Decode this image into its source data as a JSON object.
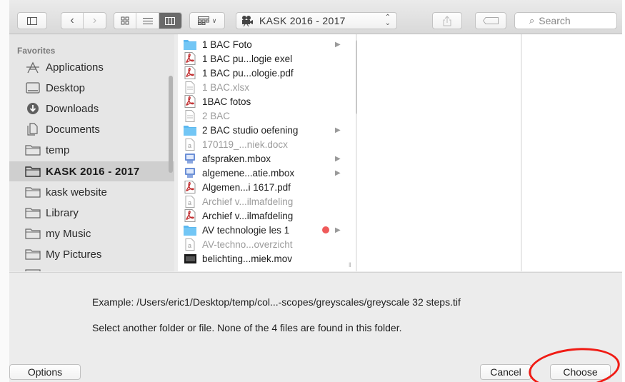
{
  "toolbar": {
    "path_title": "KASK 2016 - 2017",
    "search_placeholder": "Search"
  },
  "sidebar": {
    "section": "Favorites",
    "items": [
      {
        "label": "Applications",
        "icon": "applications-icon"
      },
      {
        "label": "Desktop",
        "icon": "desktop-icon"
      },
      {
        "label": "Downloads",
        "icon": "downloads-icon"
      },
      {
        "label": "Documents",
        "icon": "documents-icon"
      },
      {
        "label": "temp",
        "icon": "folder-icon"
      },
      {
        "label": "KASK 2016 - 2017",
        "icon": "folder-icon"
      },
      {
        "label": "kask website",
        "icon": "folder-icon"
      },
      {
        "label": "Library",
        "icon": "folder-icon"
      },
      {
        "label": "my Music",
        "icon": "folder-icon"
      },
      {
        "label": "My Pictures",
        "icon": "folder-icon"
      }
    ],
    "selected_index": 5
  },
  "files": [
    {
      "name": "1 BAC Foto",
      "type": "folder",
      "expandable": true,
      "dim": false
    },
    {
      "name": "1 BAC pu...logie exel",
      "type": "pdf",
      "dim": false
    },
    {
      "name": "1 BAC pu...ologie.pdf",
      "type": "pdf",
      "dim": false
    },
    {
      "name": "1 BAC.xlsx",
      "type": "doc",
      "dim": true
    },
    {
      "name": "1BAC fotos",
      "type": "pdf",
      "dim": false
    },
    {
      "name": "2 BAC",
      "type": "doc",
      "dim": true
    },
    {
      "name": "2 BAC studio oefening",
      "type": "folder",
      "expandable": true,
      "dim": false
    },
    {
      "name": "170119_...niek.docx",
      "type": "word",
      "dim": true
    },
    {
      "name": "afspraken.mbox",
      "type": "mbox",
      "expandable": true,
      "dim": false
    },
    {
      "name": "algemene...atie.mbox",
      "type": "mbox",
      "expandable": true,
      "dim": false
    },
    {
      "name": "Algemen...i 1617.pdf",
      "type": "pdf",
      "dim": false
    },
    {
      "name": "Archief v...ilmafdeling",
      "type": "word",
      "dim": true
    },
    {
      "name": "Archief v...ilmafdeling",
      "type": "pdf",
      "dim": false
    },
    {
      "name": "AV technologie les 1",
      "type": "folder",
      "expandable": true,
      "tag": "#ef5a5a",
      "dim": false
    },
    {
      "name": "AV-techno...overzicht",
      "type": "word",
      "dim": true
    },
    {
      "name": "belichting...miek.mov",
      "type": "movie",
      "dim": false
    }
  ],
  "message": {
    "example": "Example: /Users/eric1/Desktop/temp/col...-scopes/greyscales/greyscale 32 steps.tif",
    "hint": "Select another folder or file. None of the 4 files are found in this folder."
  },
  "buttons": {
    "options": "Options",
    "cancel": "Cancel",
    "choose": "Choose"
  },
  "colors": {
    "folder_blue": "#5bb8f0",
    "pdf_red": "#c0282a",
    "highlight": "#f01b14"
  }
}
